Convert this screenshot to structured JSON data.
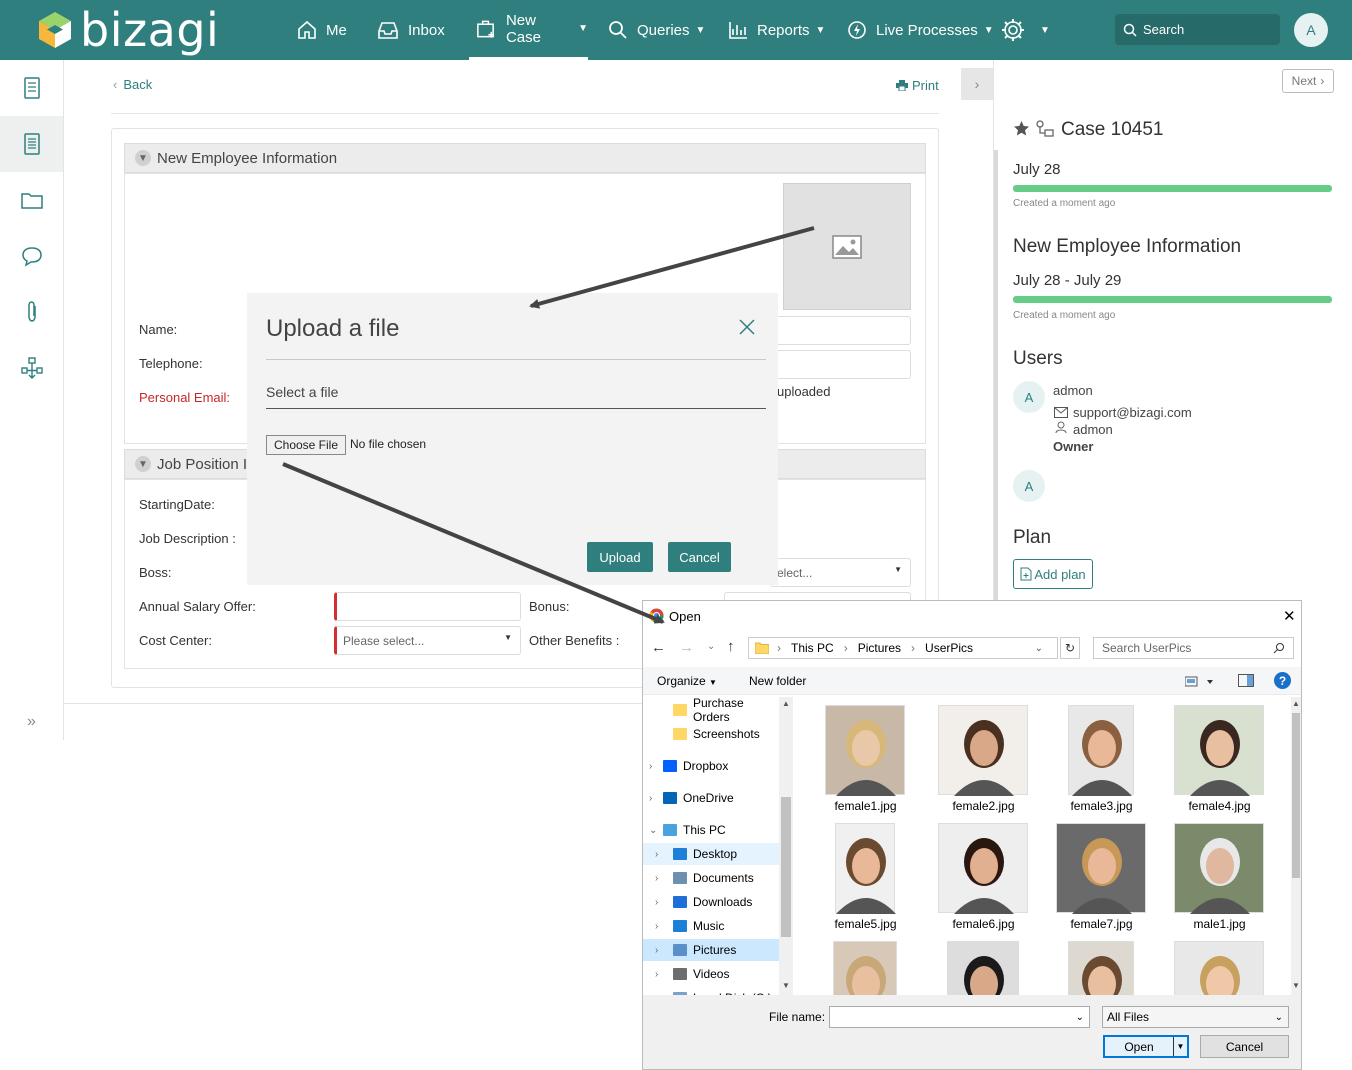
{
  "app": {
    "logo_text": "bizagi",
    "user_initial": "A"
  },
  "nav": {
    "me": "Me",
    "inbox": "Inbox",
    "new_case": "New Case",
    "queries": "Queries",
    "reports": "Reports",
    "live_processes": "Live Processes",
    "search_placeholder": "Search"
  },
  "main": {
    "back": "Back",
    "print": "Print",
    "section1_title": "New Employee Information",
    "section2_title": "Job Position Information",
    "section2_visible": "Job Position Ir",
    "labels": {
      "name": "Name:",
      "telephone": "Telephone:",
      "personal_email": "Personal Email:",
      "starting_date": "StartingDate:",
      "job_description": "Job Description :",
      "boss": "Boss:",
      "annual_salary": "Annual Salary Offer:",
      "bonus": "Bonus:",
      "cost_center": "Cost Center:",
      "other_benefits": "Other Benefits :"
    },
    "uploaded_text": "uploaded",
    "please_select": "Please select...",
    "select_partial": "elect..."
  },
  "upload_dialog": {
    "title": "Upload a file",
    "select_label": "Select a file",
    "choose_file": "Choose File",
    "no_file": "No file chosen",
    "upload": "Upload",
    "cancel": "Cancel"
  },
  "right_panel": {
    "next": "Next",
    "case_title": "Case 10451",
    "case_date": "July 28",
    "created1": "Created a moment ago",
    "task_title": "New Employee Information",
    "task_dates": "July 28 - July 29",
    "created2": "Created a moment ago",
    "users_title": "Users",
    "user_name": "admon",
    "user_email": "support@bizagi.com",
    "user_login": "admon",
    "user_role": "Owner",
    "plan_title": "Plan",
    "add_plan": "Add plan",
    "progress1": 1.0,
    "progress2": 1.0
  },
  "open_dialog": {
    "title": "Open",
    "path": [
      "This PC",
      "Pictures",
      "UserPics"
    ],
    "search_placeholder": "Search UserPics",
    "organize": "Organize",
    "new_folder": "New folder",
    "nav_items": [
      {
        "label": "Purchase Orders",
        "icon": "folder-icon",
        "indent": 2,
        "selected": false
      },
      {
        "label": "Screenshots",
        "icon": "folder-icon",
        "indent": 2,
        "selected": false
      },
      {
        "label": "Dropbox",
        "icon": "dropbox-icon",
        "indent": 1,
        "selected": false
      },
      {
        "label": "OneDrive",
        "icon": "cloud-icon",
        "indent": 1,
        "selected": false
      },
      {
        "label": "This PC",
        "icon": "computer-icon",
        "indent": 1,
        "selected": false
      },
      {
        "label": "Desktop",
        "icon": "desktop-icon",
        "indent": 2,
        "selected": true
      },
      {
        "label": "Documents",
        "icon": "documents-icon",
        "indent": 2,
        "selected": false
      },
      {
        "label": "Downloads",
        "icon": "download-icon",
        "indent": 2,
        "selected": false
      },
      {
        "label": "Music",
        "icon": "music-icon",
        "indent": 2,
        "selected": false
      },
      {
        "label": "Pictures",
        "icon": "pictures-icon",
        "indent": 2,
        "selected": true
      },
      {
        "label": "Videos",
        "icon": "videos-icon",
        "indent": 2,
        "selected": false
      },
      {
        "label": "Local Disk (C:)",
        "icon": "disk-icon",
        "indent": 2,
        "selected": false
      }
    ],
    "files": [
      {
        "name": "female1.jpg"
      },
      {
        "name": "female2.jpg"
      },
      {
        "name": "female3.jpg"
      },
      {
        "name": "female4.jpg"
      },
      {
        "name": "female5.jpg"
      },
      {
        "name": "female6.jpg"
      },
      {
        "name": "female7.jpg"
      },
      {
        "name": "male1.jpg"
      },
      {
        "name": ""
      },
      {
        "name": ""
      },
      {
        "name": ""
      },
      {
        "name": ""
      }
    ],
    "file_name_label": "File name:",
    "file_type": "All Files",
    "open_button": "Open",
    "cancel_button": "Cancel"
  },
  "colors": {
    "brand": "#2f7f7e",
    "progress": "#66cc88",
    "required": "#c62828"
  }
}
